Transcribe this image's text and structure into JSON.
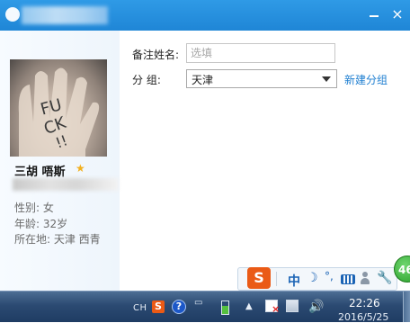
{
  "window": {
    "close_icon": "×"
  },
  "profile": {
    "nickname": "三胡 唔斯",
    "star_icon": "★",
    "gender": "性别: 女",
    "age": "年龄: 32岁",
    "location": "所在地: 天津 西青"
  },
  "form": {
    "remark_label": "备注姓名:",
    "remark_placeholder": "选填",
    "group_label": "分 组:",
    "group_value": "天津",
    "new_group_link": "新建分组"
  },
  "ime_toolbar": {
    "logo": "S",
    "mode": "中",
    "moon_icon": "☽",
    "punct": "°,",
    "wrench_icon": "🔧"
  },
  "notification_badge": "46",
  "taskbar": {
    "lang": "CH",
    "sogou": "S",
    "help": "?",
    "time": "22:26",
    "date": "2016/5/25",
    "accent": "#1f86d6"
  }
}
